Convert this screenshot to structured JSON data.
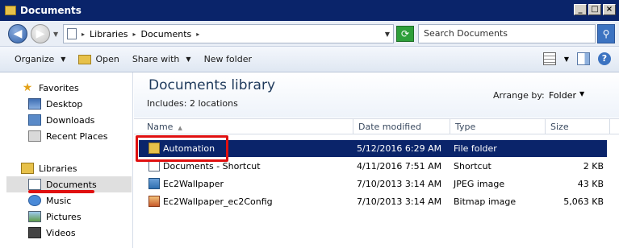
{
  "window": {
    "title": "Documents",
    "buttons": [
      "_",
      "□",
      "×"
    ]
  },
  "address": {
    "breadcrumbs": [
      "Libraries",
      "Documents"
    ],
    "search_placeholder": "Search Documents"
  },
  "toolbar": {
    "organize": "Organize",
    "open": "Open",
    "share_with": "Share with",
    "new_folder": "New folder"
  },
  "nav": {
    "favorites": {
      "label": "Favorites",
      "items": [
        "Desktop",
        "Downloads",
        "Recent Places"
      ]
    },
    "libraries": {
      "label": "Libraries",
      "items": [
        "Documents",
        "Music",
        "Pictures",
        "Videos"
      ]
    }
  },
  "library": {
    "title": "Documents library",
    "includes": "Includes:  2 locations",
    "arrange_label": "Arrange by:",
    "arrange_value": "Folder"
  },
  "columns": {
    "name": "Name",
    "date": "Date modified",
    "type": "Type",
    "size": "Size"
  },
  "files": [
    {
      "name": "Automation",
      "date": "5/12/2016 6:29 AM",
      "type": "File folder",
      "size": ""
    },
    {
      "name": "Documents - Shortcut",
      "date": "4/11/2016 7:51 AM",
      "type": "Shortcut",
      "size": "2 KB"
    },
    {
      "name": "Ec2Wallpaper",
      "date": "7/10/2013 3:14 AM",
      "type": "JPEG image",
      "size": "43 KB"
    },
    {
      "name": "Ec2Wallpaper_ec2Config",
      "date": "7/10/2013 3:14 AM",
      "type": "Bitmap image",
      "size": "5,063 KB"
    }
  ],
  "colors": {
    "titlebar": "#0a246a",
    "selection": "#0a246a",
    "highlight_red": "#e01010"
  }
}
